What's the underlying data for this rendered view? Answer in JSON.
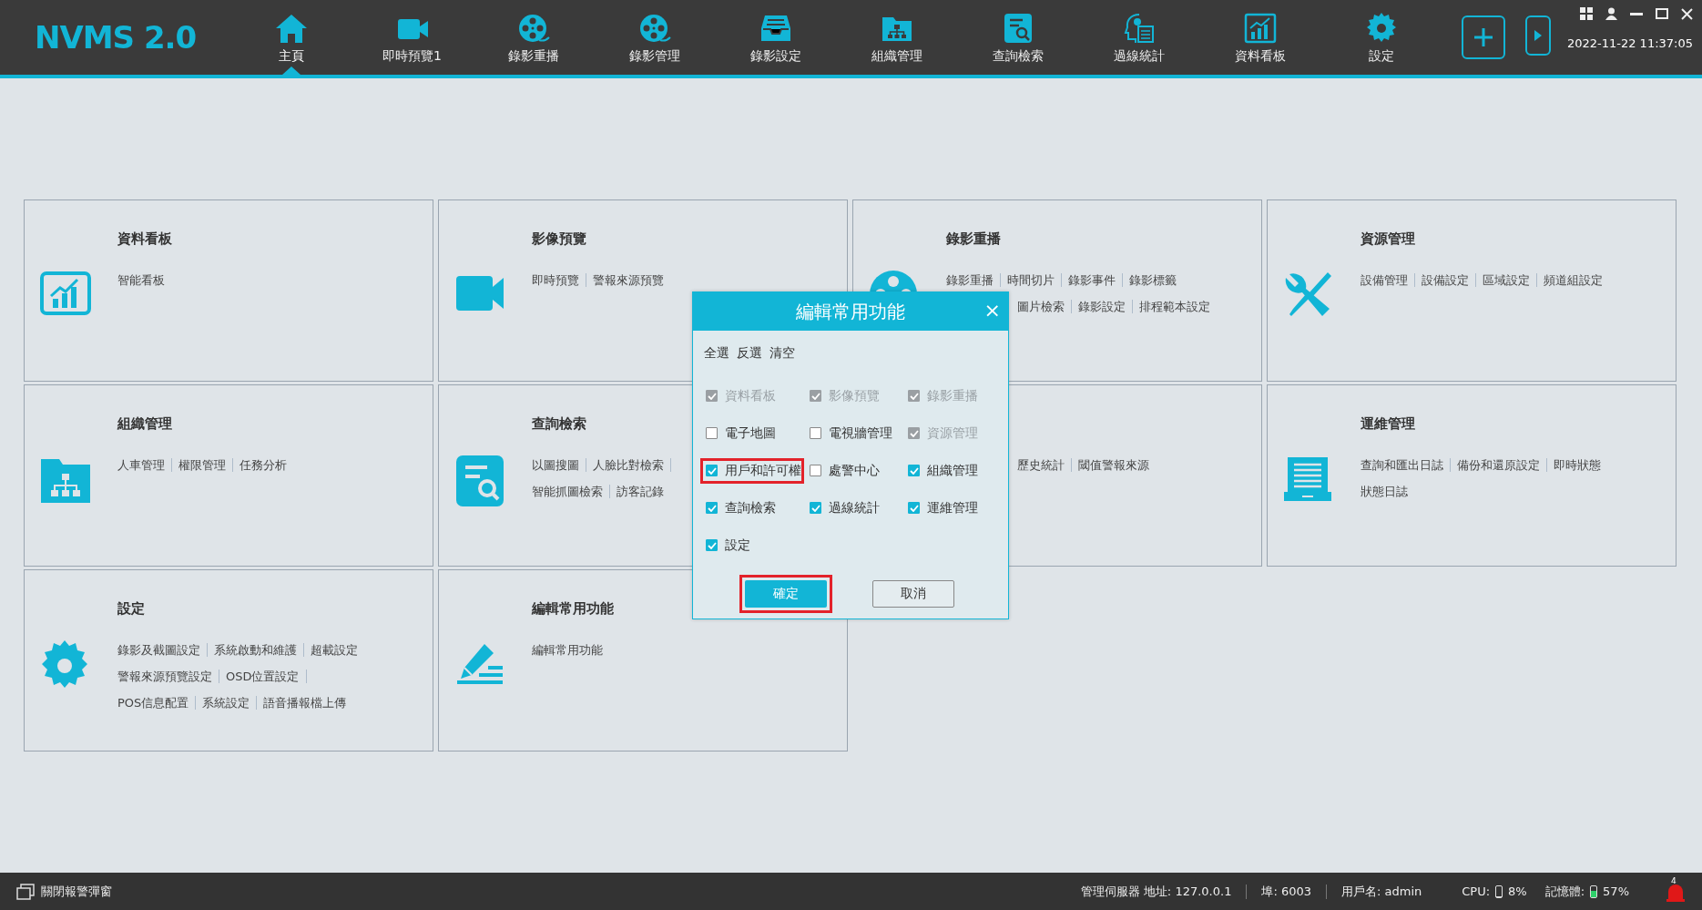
{
  "app": {
    "logo": "NVMS 2.0"
  },
  "nav": [
    {
      "label": "主頁",
      "selected": true
    },
    {
      "label": "即時預覽1",
      "selected": false
    },
    {
      "label": "錄影重播",
      "selected": false
    },
    {
      "label": "錄影管理",
      "selected": false
    },
    {
      "label": "錄影設定",
      "selected": false
    },
    {
      "label": "組織管理",
      "selected": false
    },
    {
      "label": "查詢檢索",
      "selected": false
    },
    {
      "label": "過線統計",
      "selected": false
    },
    {
      "label": "資料看板",
      "selected": false
    },
    {
      "label": "設定",
      "selected": false
    }
  ],
  "date_time": "2022-11-22 11:37:05",
  "cards": [
    {
      "title": "資料看板",
      "lines": [
        {
          "links": [
            "智能看板"
          ]
        }
      ]
    },
    {
      "title": "影像預覽",
      "lines": [
        {
          "links": [
            "即時預覽",
            "警報來源預覽"
          ]
        }
      ]
    },
    {
      "title": "錄影重播",
      "lines": [
        {
          "links": [
            "錄影重播",
            "時間切片",
            "錄影事件",
            "錄影標籤"
          ]
        },
        {
          "links": [
            "圖片檢索",
            "錄影設定",
            "排程範本設定"
          ],
          "covered_lead": true
        }
      ]
    },
    {
      "title": "資源管理",
      "lines": [
        {
          "links": [
            "設備管理",
            "設備設定",
            "區域設定",
            "頻道組設定"
          ]
        }
      ]
    },
    {
      "title": "組織管理",
      "lines": [
        {
          "links": [
            "人車管理",
            "權限管理",
            "任務分析"
          ]
        }
      ]
    },
    {
      "title": "查詢檢索",
      "lines": [
        {
          "links": [
            "以圖搜圖",
            "人臉比對檢索"
          ],
          "trailing_divider": true
        },
        {
          "links": [
            "智能抓圖檢索",
            "訪客記錄"
          ]
        }
      ]
    },
    {
      "lines": [
        {
          "links": [
            "歷史統計",
            "閾值警報來源"
          ],
          "covered_lead": true
        }
      ]
    },
    {
      "title": "運維管理",
      "lines": [
        {
          "links": [
            "查詢和匯出日誌",
            "備份和還原設定",
            "即時狀態"
          ]
        },
        {
          "links": [
            "狀態日誌"
          ]
        }
      ]
    },
    {
      "title": "設定",
      "lines": [
        {
          "links": [
            "錄影及截圖設定",
            "系統啟動和維護",
            "超載設定"
          ]
        },
        {
          "links": [
            "警報來源預覽設定",
            "OSD位置設定"
          ],
          "trailing_divider": true
        },
        {
          "links": [
            "POS信息配置",
            "系統設定",
            "語音播報檔上傳"
          ]
        }
      ]
    },
    {
      "title": "編輯常用功能",
      "lines": [
        {
          "links": [
            "編輯常用功能"
          ]
        }
      ]
    }
  ],
  "dialog": {
    "title": "編輯常用功能",
    "close": "×",
    "actions": [
      "全選",
      "反選",
      "清空"
    ],
    "options": [
      {
        "label": "資料看板",
        "checked": true,
        "disabled": true,
        "highlighted": false
      },
      {
        "label": "影像預覽",
        "checked": true,
        "disabled": true,
        "highlighted": false
      },
      {
        "label": "錄影重播",
        "checked": true,
        "disabled": true,
        "highlighted": false
      },
      {
        "label": "電子地圖",
        "checked": false,
        "disabled": false,
        "highlighted": false
      },
      {
        "label": "電視牆管理",
        "checked": false,
        "disabled": false,
        "highlighted": false
      },
      {
        "label": "資源管理",
        "checked": true,
        "disabled": true,
        "highlighted": false
      },
      {
        "label": "用戶和許可權",
        "checked": true,
        "disabled": false,
        "highlighted": true
      },
      {
        "label": "處警中心",
        "checked": false,
        "disabled": false,
        "highlighted": false
      },
      {
        "label": "組織管理",
        "checked": true,
        "disabled": false,
        "highlighted": false
      },
      {
        "label": "查詢檢索",
        "checked": true,
        "disabled": false,
        "highlighted": false
      },
      {
        "label": "過線統計",
        "checked": true,
        "disabled": false,
        "highlighted": false
      },
      {
        "label": "運維管理",
        "checked": true,
        "disabled": false,
        "highlighted": false
      },
      {
        "label": "設定",
        "checked": true,
        "disabled": false,
        "highlighted": false
      }
    ],
    "buttons": [
      {
        "label": "確定",
        "kind": "primary",
        "highlighted": true
      },
      {
        "label": "取消",
        "kind": "secondary",
        "highlighted": false
      }
    ]
  },
  "status_bar": {
    "close_alarm_popup": "關閉報警彈窗",
    "server": "管理伺服器 地址: 127.0.0.1",
    "port": "埠: 6003",
    "user": "用戶名: admin",
    "cpu_label": "CPU:",
    "cpu": {
      "level": 0.08,
      "reading": "8%"
    },
    "memory_label": "記憶體:",
    "memory": {
      "level": 0.57,
      "reading": "57%"
    },
    "alarm_count": "4"
  }
}
